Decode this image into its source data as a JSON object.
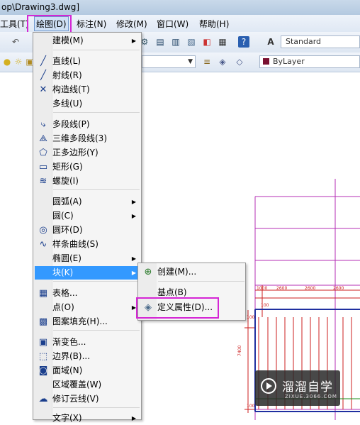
{
  "window": {
    "title": "op\\Drawing3.dwg]"
  },
  "menubar": {
    "items": [
      {
        "label": "工具(T)"
      },
      {
        "label": "绘图(D)"
      },
      {
        "label": "标注(N)"
      },
      {
        "label": "修改(M)"
      },
      {
        "label": "窗口(W)"
      },
      {
        "label": "帮助(H)"
      }
    ],
    "active_index": 1
  },
  "toolbar": {
    "text_style": "Standard",
    "layer_color": "ByLayer"
  },
  "draw_menu": {
    "items": [
      {
        "label": "建模(M)",
        "icon": "",
        "submenu": true
      },
      {
        "label": "直线(L)",
        "icon": "line-icon",
        "glyph": "╱"
      },
      {
        "label": "射线(R)",
        "icon": "ray-icon",
        "glyph": "╱"
      },
      {
        "label": "构造线(T)",
        "icon": "xline-icon",
        "glyph": "✕"
      },
      {
        "label": "多线(U)",
        "icon": ""
      },
      {
        "label": "多段线(P)",
        "icon": "polyline-icon",
        "glyph": "⤷"
      },
      {
        "label": "三维多段线(3)",
        "icon": "3dpoly-icon",
        "glyph": "⟁"
      },
      {
        "label": "正多边形(Y)",
        "icon": "polygon-icon",
        "glyph": "⬠"
      },
      {
        "label": "矩形(G)",
        "icon": "rectangle-icon",
        "glyph": "▭"
      },
      {
        "label": "螺旋(I)",
        "icon": "helix-icon",
        "glyph": "≋"
      },
      {
        "label": "圆弧(A)",
        "icon": "",
        "submenu": true
      },
      {
        "label": "圆(C)",
        "icon": "",
        "submenu": true
      },
      {
        "label": "圆环(D)",
        "icon": "donut-icon",
        "glyph": "◎"
      },
      {
        "label": "样条曲线(S)",
        "icon": "spline-icon",
        "glyph": "∿"
      },
      {
        "label": "椭圆(E)",
        "icon": "",
        "submenu": true
      },
      {
        "label": "块(K)",
        "icon": "",
        "submenu": true
      },
      {
        "label": "表格...",
        "icon": "table-icon",
        "glyph": "▦"
      },
      {
        "label": "点(O)",
        "icon": "",
        "submenu": true
      },
      {
        "label": "图案填充(H)...",
        "icon": "hatch-icon",
        "glyph": "▩"
      },
      {
        "label": "渐变色...",
        "icon": "gradient-icon",
        "glyph": "▣"
      },
      {
        "label": "边界(B)...",
        "icon": "boundary-icon",
        "glyph": "⬚"
      },
      {
        "label": "面域(N)",
        "icon": "region-icon",
        "glyph": "◙"
      },
      {
        "label": "区域覆盖(W)",
        "icon": ""
      },
      {
        "label": "修订云线(V)",
        "icon": "revcloud-icon",
        "glyph": "☁"
      },
      {
        "label": "文字(X)",
        "icon": "",
        "submenu": true
      }
    ],
    "selected_index": 15
  },
  "block_submenu": {
    "items": [
      {
        "label": "创建(M)...",
        "icon": "create-block-icon",
        "glyph": "⊕"
      },
      {
        "label": "基点(B)",
        "icon": ""
      },
      {
        "label": "定义属性(D)...",
        "icon": "define-attribute-icon",
        "glyph": "◈"
      }
    ]
  },
  "drawing": {
    "dims_top": [
      "1000",
      "2600",
      "2600",
      "2600"
    ],
    "dims_left": [
      "100",
      "100",
      "7400",
      "100"
    ],
    "colors": {
      "red": "#cc1f1f",
      "magenta": "#b42fb4",
      "blue": "#1f2fa0",
      "green": "#1a8f1a"
    }
  },
  "watermark": {
    "main": "溜溜自学",
    "sub": "ZIXUE.3066.COM"
  },
  "highlight_color": "#d526d5"
}
